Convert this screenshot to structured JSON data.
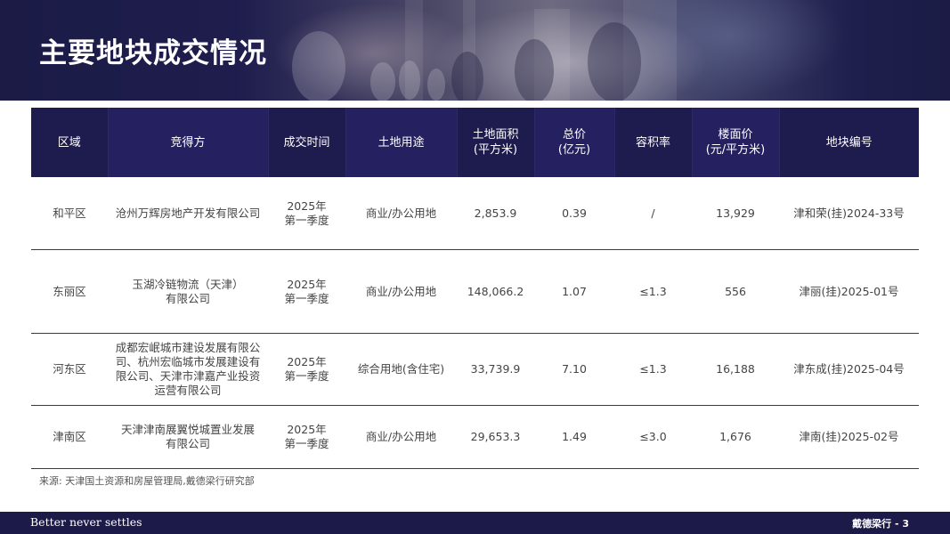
{
  "header": {
    "title": "主要地块成交情况"
  },
  "table": {
    "columns": [
      "区域",
      "竞得方",
      "成交时间",
      "土地用途",
      "土地面积\n(平方米)",
      "总价\n(亿元)",
      "容积率",
      "楼面价\n(元/平方米)",
      "地块编号"
    ],
    "rows": [
      [
        "和平区",
        "沧州万辉房地产开发有限公司",
        "2025年\n第一季度",
        "商业/办公用地",
        "2,853.9",
        "0.39",
        "/",
        "13,929",
        "津和荣(挂)2024-33号"
      ],
      [
        "东丽区",
        "玉湖冷链物流（天津）\n有限公司",
        "2025年\n第一季度",
        "商业/办公用地",
        "148,066.2",
        "1.07",
        "≤1.3",
        "556",
        "津丽(挂)2025-01号"
      ],
      [
        "河东区",
        "成都宏岷城市建设发展有限公\n司、杭州宏临城市发展建设有\n限公司、天津市津嘉产业投资\n运营有限公司",
        "2025年\n第一季度",
        "综合用地(含住宅)",
        "33,739.9",
        "7.10",
        "≤1.3",
        "16,188",
        "津东成(挂)2025-04号"
      ],
      [
        "津南区",
        "天津津南展翼悦城置业发展\n有限公司",
        "2025年\n第一季度",
        "商业/办公用地",
        "29,653.3",
        "1.49",
        "≤3.0",
        "1,676",
        "津南(挂)2025-02号"
      ]
    ]
  },
  "source": "来源: 天津国土资源和房屋管理局,戴德梁行研究部",
  "footer": {
    "tagline": "Better never settles",
    "page_label": "戴德梁行 - 3"
  },
  "colors": {
    "brand_navy": "#1c1a48",
    "header_cell": "#1e1b4f",
    "header_cell_alt": "#252160"
  }
}
